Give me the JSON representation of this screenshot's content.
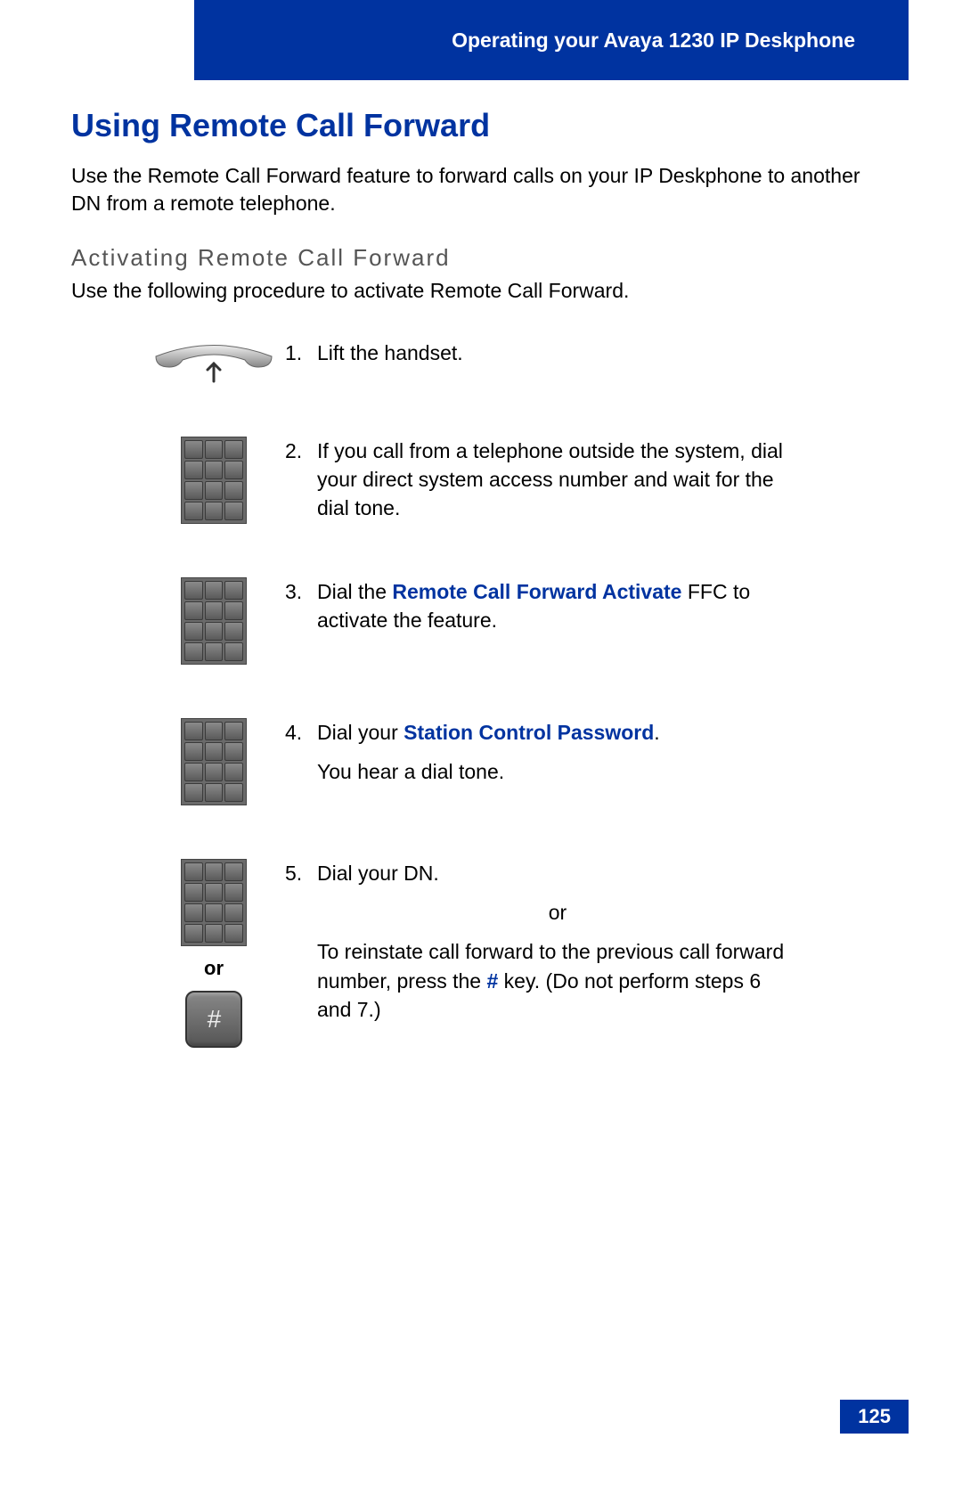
{
  "header": {
    "title": "Operating your Avaya 1230 IP Deskphone"
  },
  "main": {
    "heading": "Using Remote Call Forward",
    "intro": "Use the Remote Call Forward feature to forward calls on your IP Deskphone to another DN from a remote telephone.",
    "subheading": "Activating Remote Call Forward",
    "subintro": "Use the following procedure to activate Remote Call Forward."
  },
  "steps": {
    "s1": {
      "num": "1.",
      "text": "Lift the handset."
    },
    "s2": {
      "num": "2.",
      "text": "If you call from a telephone outside the system, dial your direct system access number and wait for the dial tone."
    },
    "s3": {
      "num": "3.",
      "pre": "Dial the ",
      "term": "Remote Call Forward Activate",
      "post": " FFC to activate the feature."
    },
    "s4": {
      "num": "4.",
      "pre": "Dial your ",
      "term": "Station Control Password",
      "post": ".",
      "line2": "You hear a dial tone."
    },
    "s5": {
      "num": "5.",
      "line1": "Dial your DN.",
      "or": "or",
      "line2a": "To reinstate call forward to the previous call forward number, press the ",
      "hash": "#",
      "line2b": " key. (Do not perform steps 6 and 7.)",
      "icon_or": "or"
    }
  },
  "page": {
    "number": "125"
  }
}
